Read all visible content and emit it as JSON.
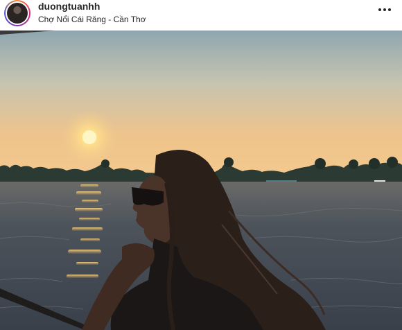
{
  "post": {
    "username": "duongtuanhh",
    "location": "Chợ Nổi Cái Răng - Cần Thơ",
    "more_icon": "more-horizontal-icon",
    "avatar_icon": "profile-avatar",
    "photo": {
      "description_icon": "sunset-river-photo",
      "colors": {
        "sky_top": "#9db0b8",
        "sky_horizon": "#f0c48a",
        "sun": "#fff2b0",
        "water": "#3f4650",
        "silhouette": "#1a1614"
      }
    }
  }
}
